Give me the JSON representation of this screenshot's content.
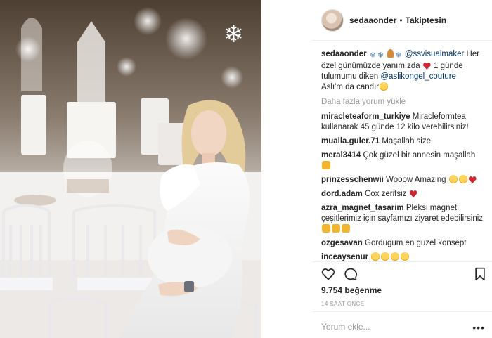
{
  "post": {
    "username": "sedaaonder",
    "separator": "•",
    "follow_status": "Takiptesin",
    "photo_alt": "",
    "caption": {
      "user": "sedaaonder",
      "mention1": "@ssvisualmaker",
      "text1": " Her özel günümüzde yanımızda ",
      "text2": " 1 günde tulumumu diken ",
      "mention2": "@aslikongel_couture",
      "text3": " Aslı'm da candır"
    },
    "more_comments": "Daha fazla yorum yükle",
    "comments": [
      {
        "user": "miracleteaform_turkiye",
        "text": "Miracleformtea kullanarak 45 günde 12 kilo verebilirsiniz!"
      },
      {
        "user": "mualla.guler.71",
        "text": "Maşallah size"
      },
      {
        "user": "meral3414",
        "text": "Çok güzel bir annesin maşallah"
      },
      {
        "user": "prinzesschenwii",
        "text": "Wooow Amazing"
      },
      {
        "user": "dord.adam",
        "text": "Cox zerifsiz"
      },
      {
        "user": "azra_magnet_tasarim",
        "text": "Pleksi magnet çeşitlerimiz için sayfamızı ziyaret edebilirsiniz"
      },
      {
        "user": "ozgesavan",
        "text": "Gordugum en guzel konsept"
      },
      {
        "user": "inceaysenur",
        "text": ""
      }
    ],
    "likes": "9.754 beğenme",
    "time": "14 SAAT ÖNCE",
    "comment_placeholder": "Yorum ekle...",
    "options": "•••"
  },
  "colors": {
    "mention": "#003569",
    "muted": "#999999",
    "heart": "#d0242f",
    "emoji": "#ffd45c"
  }
}
